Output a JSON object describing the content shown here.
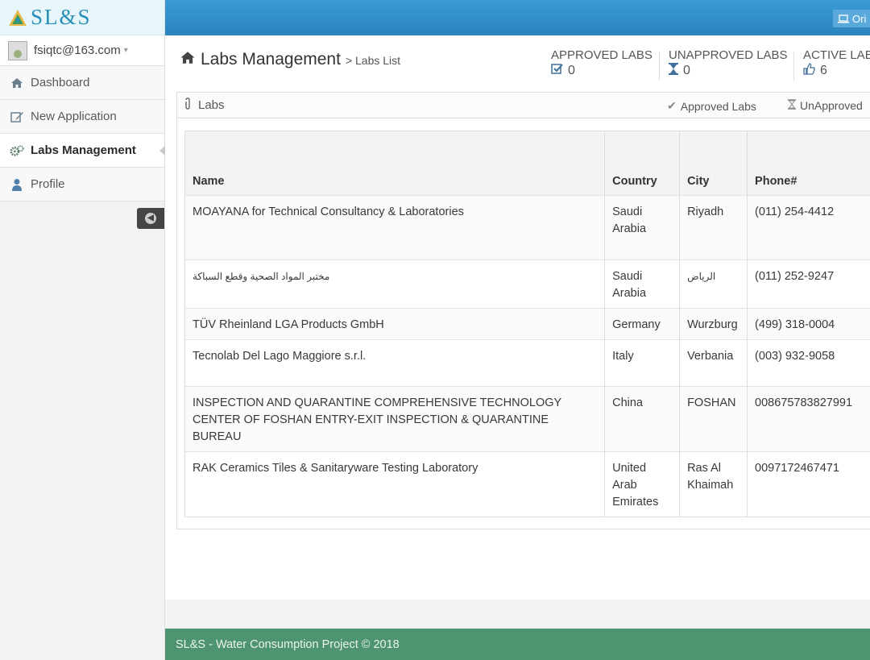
{
  "sidebar": {
    "logo": "SL&S",
    "user_email": "fsiqtc@163.com",
    "items": [
      {
        "label": "Dashboard"
      },
      {
        "label": "New Application"
      },
      {
        "label": "Labs Management"
      },
      {
        "label": "Profile"
      }
    ]
  },
  "topbar": {
    "user_button": "Ori"
  },
  "header": {
    "title": "Labs Management",
    "breadcrumb": "> Labs List"
  },
  "stats": {
    "approved": {
      "label": "APPROVED LABS",
      "value": "0"
    },
    "unapproved": {
      "label": "UNAPPROVED LABS",
      "value": "0"
    },
    "active": {
      "label": "ACTIVE LABS",
      "value": "6"
    }
  },
  "panel": {
    "title": "Labs",
    "tab_approved": "Approved Labs",
    "tab_unapproved": "UnApproved"
  },
  "table": {
    "columns": [
      "Name",
      "Country",
      "City",
      "Phone#"
    ],
    "rows": [
      [
        "MOAYANA for Technical Consultancy & Laboratories",
        "Saudi Arabia",
        "Riyadh",
        "(011) 254-4412"
      ],
      [
        "مختبر المواد الصحية وقطع السباكة",
        "Saudi Arabia",
        "الرياض",
        "(011) 252-9247"
      ],
      [
        "TÜV Rheinland LGA Products GmbH",
        "Germany",
        "Wurzburg",
        "(499) 318-0004"
      ],
      [
        "Tecnolab Del Lago Maggiore s.r.l.",
        "Italy",
        "Verbania",
        "(003) 932-9058"
      ],
      [
        "INSPECTION AND QUARANTINE COMPREHENSIVE TECHNOLOGY CENTER OF FOSHAN ENTRY-EXIT INSPECTION & QUARANTINE BUREAU",
        "China",
        "FOSHAN",
        "008675783827991"
      ],
      [
        "RAK Ceramics Tiles & Sanitaryware Testing Laboratory",
        "United Arab Emirates",
        "Ras Al Khaimah",
        "0097172467471"
      ]
    ]
  },
  "footer": {
    "text": "SL&S - Water Consumption Project © 2018"
  }
}
